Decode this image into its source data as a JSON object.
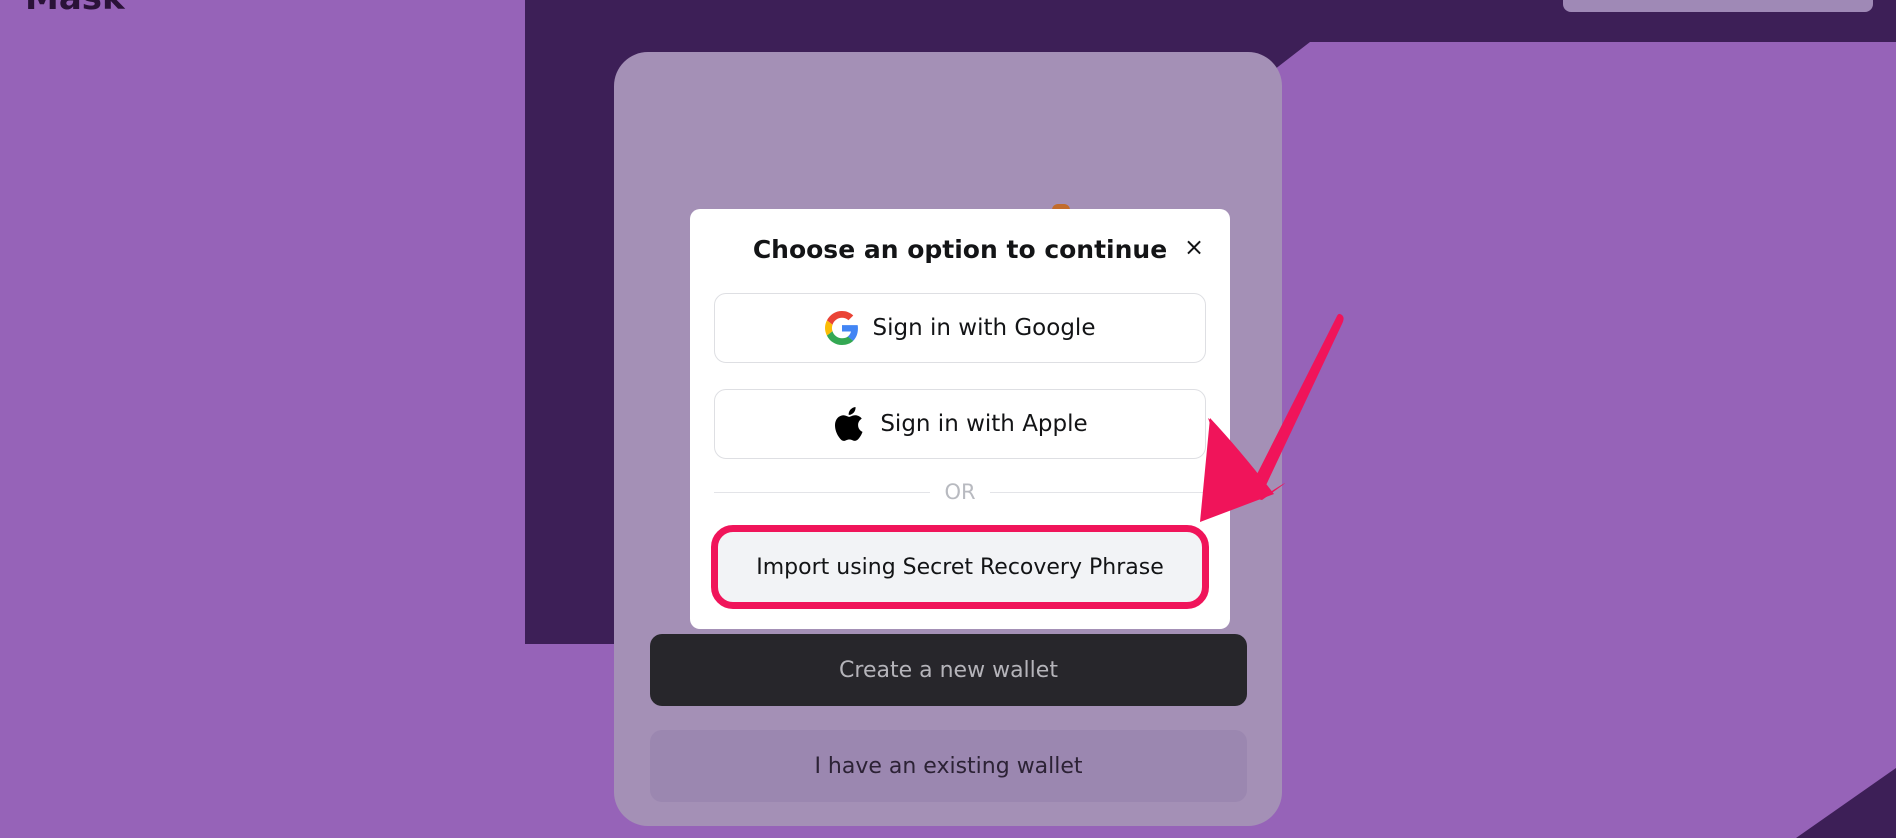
{
  "header": {
    "logo_text": "Mask"
  },
  "onboarding": {
    "create_label": "Create a new wallet",
    "existing_label": "I have an existing wallet"
  },
  "modal": {
    "title": "Choose an option to continue",
    "close_glyph": "×",
    "google_label": "Sign in with Google",
    "apple_label": "Sign in with Apple",
    "divider_label": "OR",
    "import_label": "Import using Secret Recovery Phrase"
  },
  "icons": {
    "google": "google-icon",
    "apple": "apple-icon",
    "close": "close-icon"
  },
  "colors": {
    "background_purple": "#9663b8",
    "background_dark": "#3d1f57",
    "highlight_pink": "#f0145a",
    "create_button": "#27262b"
  }
}
